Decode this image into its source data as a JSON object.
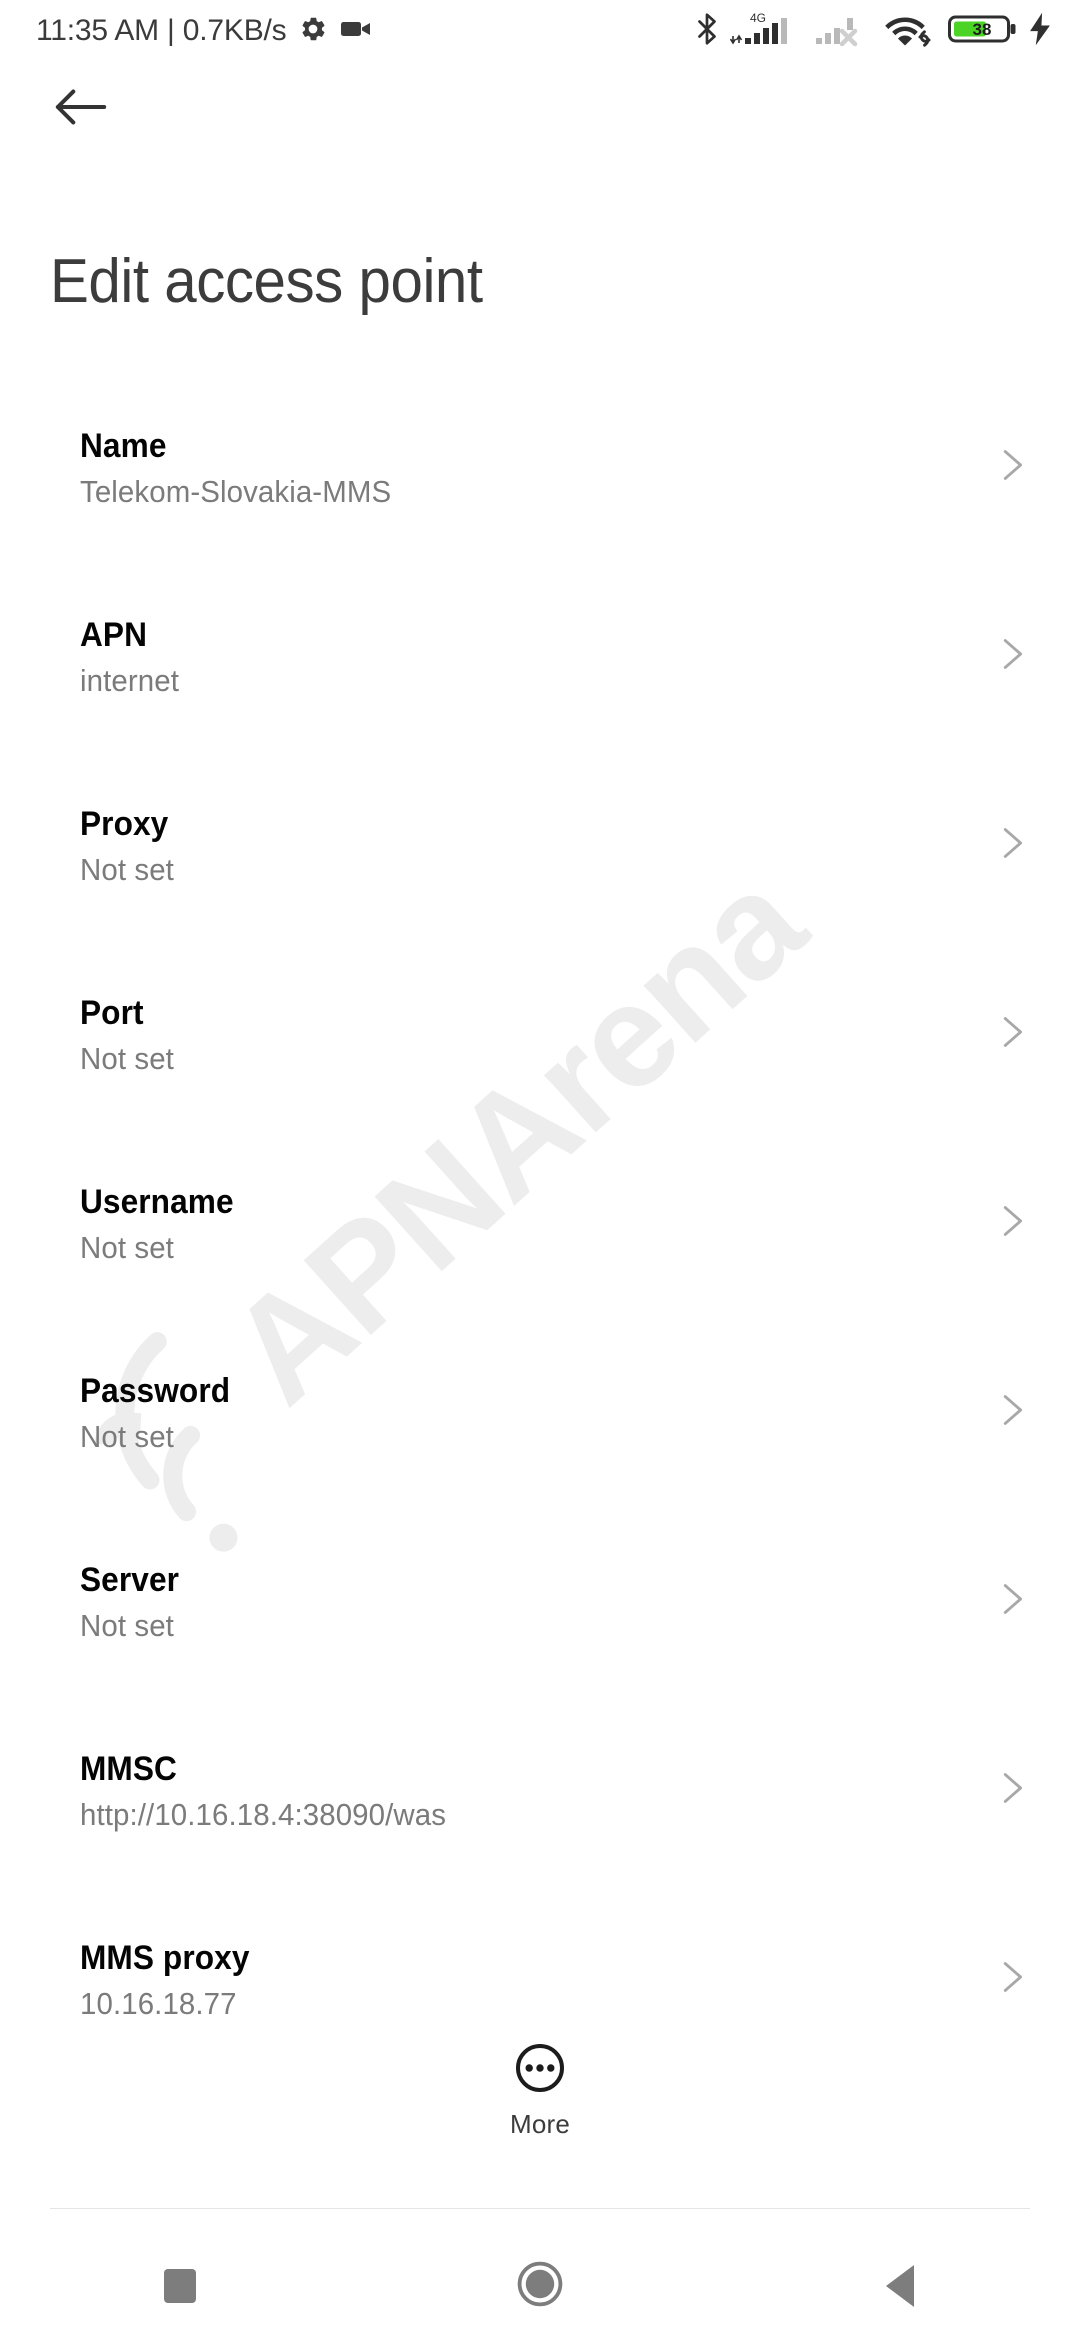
{
  "status_bar": {
    "clock_text": "11:35 AM | 0.7KB/s",
    "gear_icon": "gear-icon",
    "camcorder_icon": "camcorder-icon",
    "bluetooth_icon": "bluetooth-icon",
    "network_type_label": "4G",
    "sim1_signal_icon": "signal-bars-icon",
    "sim2_signal_icon": "signal-bars-no-service-icon",
    "wifi_icon": "wifi-icon",
    "battery_level": "38",
    "charging_icon": "charging-bolt-icon"
  },
  "header": {
    "back_icon": "arrow-left-icon",
    "title": "Edit access point"
  },
  "watermark": {
    "text": "APNArena",
    "icon": "wifi-arcs-icon",
    "color": "#ededed"
  },
  "list": {
    "chevron_icon": "chevron-right-icon",
    "rows": [
      {
        "title": "Name",
        "value": "Telekom-Slovakia-MMS"
      },
      {
        "title": "APN",
        "value": "internet"
      },
      {
        "title": "Proxy",
        "value": "Not set"
      },
      {
        "title": "Port",
        "value": "Not set"
      },
      {
        "title": "Username",
        "value": "Not set"
      },
      {
        "title": "Password",
        "value": "Not set"
      },
      {
        "title": "Server",
        "value": "Not set"
      },
      {
        "title": "MMSC",
        "value": "http://10.16.18.4:38090/was"
      },
      {
        "title": "MMS proxy",
        "value": "10.16.18.77"
      }
    ]
  },
  "more": {
    "label": "More",
    "icon": "more-circle-icon"
  },
  "nav_bar": {
    "recents_icon": "square-recents-icon",
    "home_icon": "circle-home-icon",
    "back_icon": "triangle-back-icon"
  }
}
